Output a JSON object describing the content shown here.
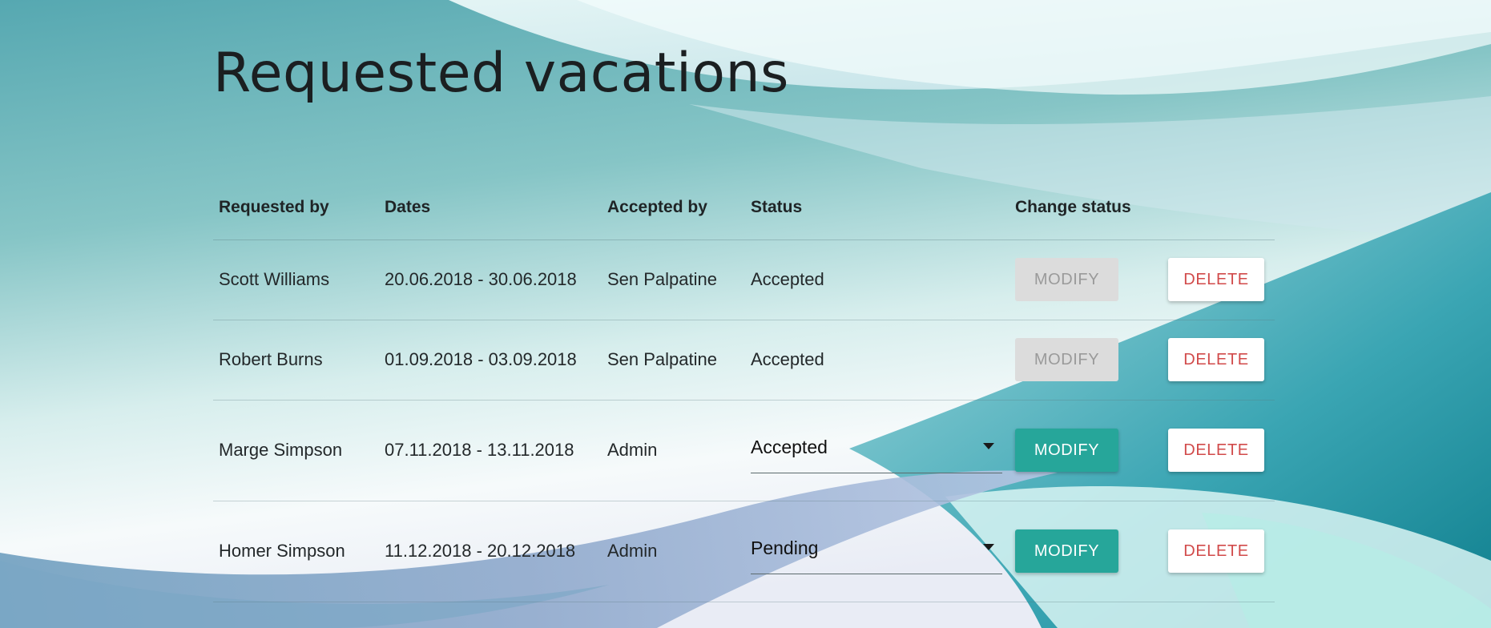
{
  "page": {
    "title": "Requested vacations"
  },
  "table": {
    "headers": {
      "requested_by": "Requested by",
      "dates": "Dates",
      "accepted_by": "Accepted by",
      "status": "Status",
      "change_status": "Change status"
    },
    "rows": [
      {
        "requested_by": "Scott Williams",
        "dates": "20.06.2018 - 30.06.2018",
        "accepted_by": "Sen Palpatine",
        "status": "Accepted",
        "modify_label": "MODIFY",
        "delete_label": "DELETE"
      },
      {
        "requested_by": "Robert Burns",
        "dates": "01.09.2018 - 03.09.2018",
        "accepted_by": "Sen Palpatine",
        "status": "Accepted",
        "modify_label": "MODIFY",
        "delete_label": "DELETE"
      },
      {
        "requested_by": "Marge Simpson",
        "dates": "07.11.2018 - 13.11.2018",
        "accepted_by": "Admin",
        "status_select": "Accepted",
        "modify_label": "MODIFY",
        "delete_label": "DELETE"
      },
      {
        "requested_by": "Homer Simpson",
        "dates": "11.12.2018 - 20.12.2018",
        "accepted_by": "Admin",
        "status_select": "Pending",
        "modify_label": "MODIFY",
        "delete_label": "DELETE"
      }
    ]
  },
  "colors": {
    "modify_active": "#26a69a",
    "modify_disabled": "#dcdcdc",
    "delete_text": "#d14a4a"
  }
}
